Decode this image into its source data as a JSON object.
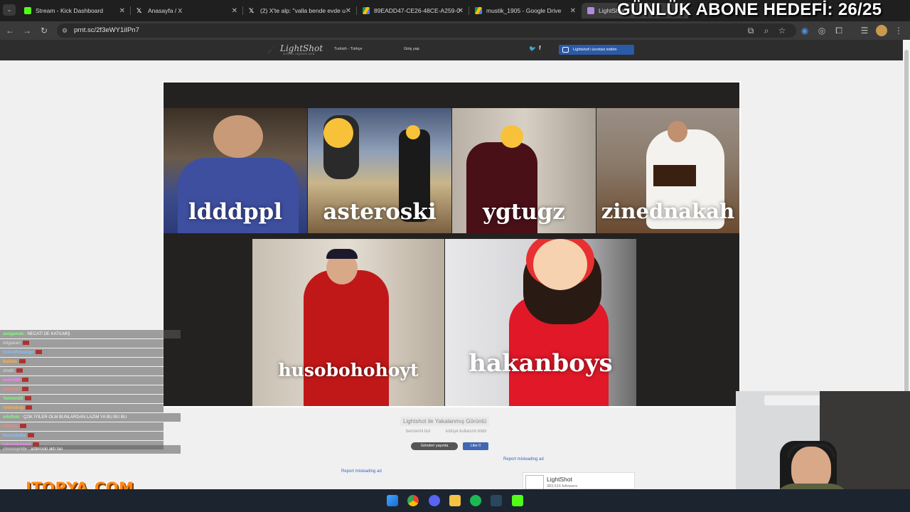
{
  "browser": {
    "tabs": [
      {
        "label": "Stream - Kick Dashboard",
        "favicon_color": "#53fc18"
      },
      {
        "label": "Anasayfa / X",
        "favicon_color": "#ffffff"
      },
      {
        "label": "(2) X'te alp: \"valla bende evde u",
        "favicon_color": "#ffffff"
      },
      {
        "label": "89EADD47-CE26-48CE-A259-0",
        "favicon_color": "#4285f4"
      },
      {
        "label": "mustik_1905 - Google Drive",
        "favicon_color": "#fbbc04"
      },
      {
        "label": "LightShot",
        "favicon_color": "#b08ae0"
      }
    ],
    "url": "prnt.sc/2f3eWY1iIPn7"
  },
  "overlay": {
    "goal_text": "GÜNLÜK ABONE HEDEFİ: 26/25",
    "sponsor_logo": "ITOPYA.COM"
  },
  "lightshot": {
    "logo": "LightShot",
    "logo_sub": "screen capture tool",
    "language": "Turkish - Türkçe",
    "login": "Giriş yap",
    "download": "Lightshot'ı ücretsiz indirin",
    "screenshot_title": "Lightshot ile Yakalanmış Görüntü",
    "similar": "benzerini bul",
    "report_abuse": "kötüye kullanımı bildir",
    "tweet": "Gönderi yayınla",
    "like": "Like 0",
    "report_ad_1": "Report misleading ad",
    "report_ad_2": "Report misleading ad",
    "card_name": "LightShot",
    "card_followers": "383,516 followers"
  },
  "screenshot": {
    "captions": [
      "ldddppl",
      "asteroski",
      "ygtugz",
      "zinednakah",
      "husobohohoyt",
      "hakanboys"
    ]
  },
  "chat": {
    "lines": [
      {
        "user": "sengamak",
        "color": "#7fff7f",
        "text": "NECATİ DE KATILMIŞ"
      },
      {
        "user": "tolgakarl",
        "color": "#cfcfcf",
        "text": ""
      },
      {
        "user": "S1lentR3venge",
        "color": "#80c0ff",
        "text": ""
      },
      {
        "user": "Balkan",
        "color": "#ffb040",
        "text": ""
      },
      {
        "user": "zindir",
        "color": "#cfcfcf",
        "text": ""
      },
      {
        "user": "mrbrn00",
        "color": "#ff80ff",
        "text": ""
      },
      {
        "user": "semer33",
        "color": "#ff8080",
        "text": ""
      },
      {
        "user": "Yeniren25",
        "color": "#7fff7f",
        "text": ""
      },
      {
        "user": "rollendrag",
        "color": "#ffb040",
        "text": ""
      },
      {
        "user": "mfoflnkr",
        "color": "#7fff7f",
        "text": "ÇOK İYİLER OLM BUNLARDAN LAZIM YA BU BU BU"
      },
      {
        "user": "PIRmer",
        "color": "#ff8080",
        "text": ""
      },
      {
        "user": "hussobaba",
        "color": "#80c0ff",
        "text": ""
      },
      {
        "user": "hikmetipromk",
        "color": "#ff80ff",
        "text": ""
      },
      {
        "user": "cinsnopride",
        "color": "#cfcfcf",
        "text": "asteroski aktı lan"
      },
      {
        "user": "",
        "color": "#cfcfcf",
        "text": ""
      }
    ]
  }
}
